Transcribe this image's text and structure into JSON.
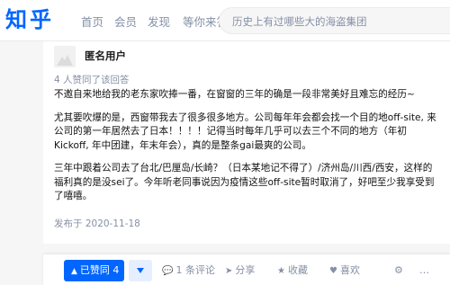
{
  "header": {
    "logo": "知乎",
    "nav": [
      "首页",
      "会员",
      "发现",
      "等你来答"
    ],
    "search_placeholder": "历史上有过哪些大的海盗集团"
  },
  "answer": {
    "author": "匿名用户",
    "voters": "4 人赞同了该回答",
    "paragraphs": [
      "不邀自来地给我的老东家吹捧一番，在窗窗的三年的确是一段非常美好且难忘的经历~",
      "尤其要吹爆的是，西窗带我去了很多很多地方。公司每年年会都会找一个目的地off-site, 来公司的第一年居然去了日本！！！！记得当时每年几乎可以去三个不同的地方（年初Kickoff, 年中团建，年末年会），真的是整条gai最爽的公司。",
      "三年中跟着公司去了台北/巴厘岛/长崎？（日本某地记不得了）/济州岛/川西/西安，这样的福利真的是没sei了。今年听老同事说因为疫情这些off-site暂时取消了，好吧至少我享受到了嘻嘻。"
    ],
    "published": "发布于 2020-11-18"
  },
  "actions": {
    "upvote": "已赞同 4",
    "comment": "1 条评论",
    "share": "分享",
    "favorite": "收藏",
    "like": "喜欢"
  }
}
